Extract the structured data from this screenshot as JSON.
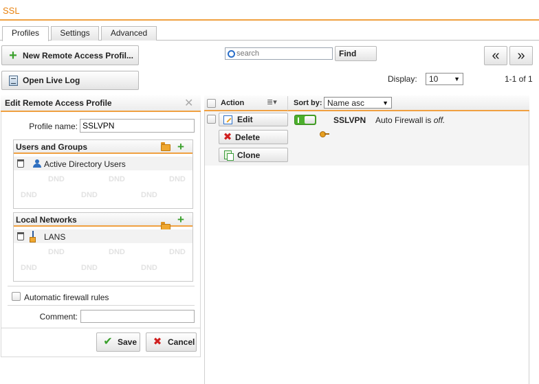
{
  "app": {
    "title": "SSL"
  },
  "tabs": [
    {
      "label": "Profiles",
      "active": true
    },
    {
      "label": "Settings",
      "active": false
    },
    {
      "label": "Advanced",
      "active": false
    }
  ],
  "toolbar": {
    "new_profile_label": "New Remote Access Profil...",
    "open_log_label": "Open Live Log",
    "search_placeholder": "search",
    "find_label": "Find",
    "prev_page": "«",
    "next_page": "»",
    "display_label": "Display:",
    "display_value": "10",
    "page_info": "1-1 of 1"
  },
  "edit_panel": {
    "title": "Edit Remote Access Profile",
    "profile_name_label": "Profile name:",
    "profile_name_value": "SSLVPN",
    "users_groups": {
      "title": "Users and Groups",
      "items": [
        {
          "label": "Active Directory Users",
          "icon": "users-icon"
        }
      ]
    },
    "local_networks": {
      "title": "Local Networks",
      "items": [
        {
          "label": "LANS",
          "icon": "network-icon"
        }
      ]
    },
    "dnd_text": "DND",
    "auto_firewall_label": "Automatic firewall rules",
    "auto_firewall_checked": false,
    "comment_label": "Comment:",
    "comment_value": "",
    "save_label": "Save",
    "cancel_label": "Cancel"
  },
  "grid": {
    "action_header": "Action",
    "sort_label": "Sort by:",
    "sort_value": "Name asc",
    "rows": [
      {
        "name": "SSLVPN",
        "enabled": true,
        "status_prefix": "Auto Firewall is ",
        "status_value": "off.",
        "actions": {
          "edit": "Edit",
          "delete": "Delete",
          "clone": "Clone"
        }
      }
    ]
  },
  "colors": {
    "accent": "#e8800c",
    "rule": "#f0a040",
    "toggle_on": "#4caf2c",
    "delete": "#d02020"
  }
}
